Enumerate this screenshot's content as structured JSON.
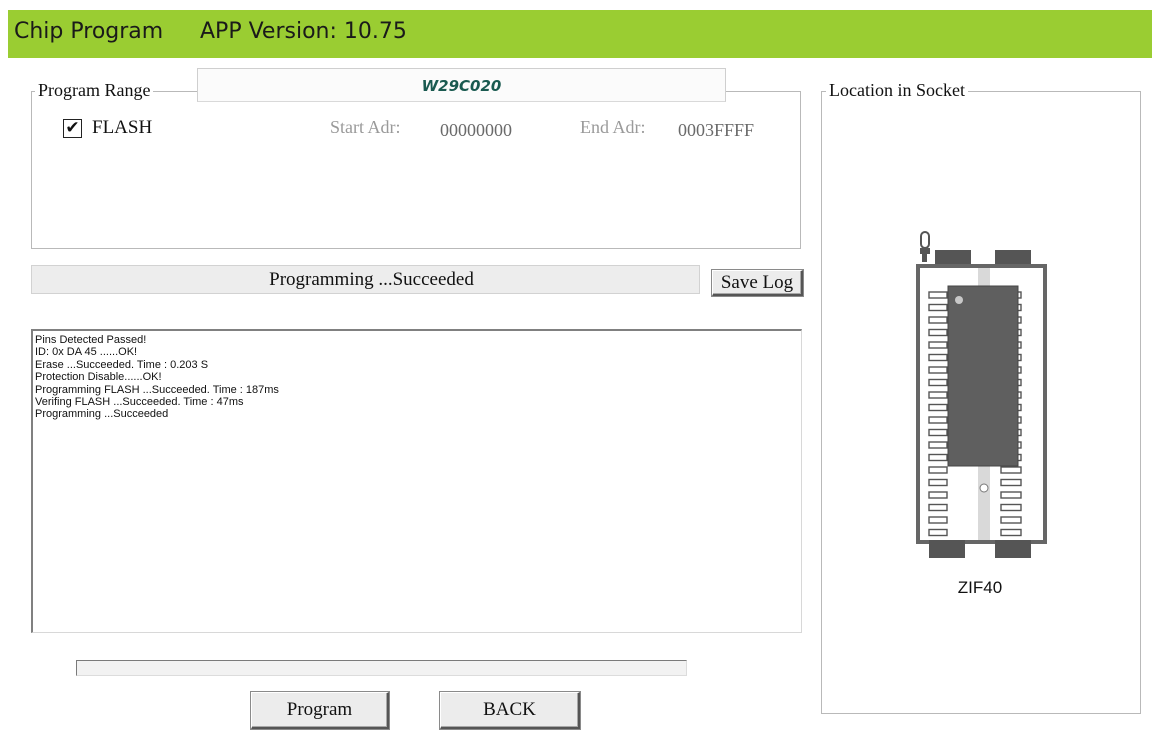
{
  "header": {
    "title": "Chip Program",
    "version": "APP Version: 10.75",
    "accent_color": "#9acd32"
  },
  "program_range": {
    "legend": "Program Range",
    "chip_name": "W29C020",
    "flash": {
      "label": "FLASH",
      "checked": true,
      "start_label": "Start Adr:",
      "start_value": "00000000",
      "end_label": "End Adr:",
      "end_value": "0003FFFF"
    }
  },
  "status": {
    "text": "Programming  ...Succeeded"
  },
  "buttons": {
    "save_log": "Save Log",
    "program": "Program",
    "back": "BACK"
  },
  "log": {
    "lines": [
      "Pins Detected Passed!",
      "ID: 0x DA 45 ......OK!",
      "Erase  ...Succeeded. Time : 0.203 S",
      "Protection Disable......OK!",
      "Programming FLASH ...Succeeded. Time : 187ms",
      "Verifing FLASH ...Succeeded. Time : 47ms",
      "Programming  ...Succeeded"
    ]
  },
  "progress": {
    "fraction": 0.0
  },
  "socket": {
    "legend": "Location in Socket",
    "label": "ZIF40",
    "pins_per_side": 20,
    "chip_pins_per_side": 16
  }
}
